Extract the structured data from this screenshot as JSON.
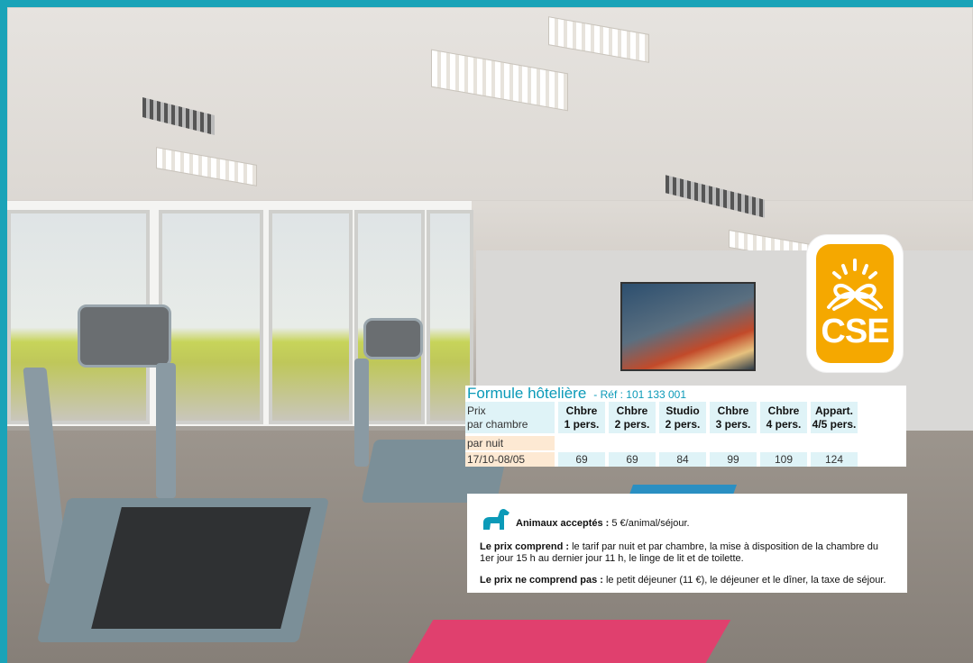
{
  "badge": {
    "label": "CSE",
    "accent": "#f5a800"
  },
  "formula": {
    "title": "Formule hôtelière",
    "ref": "- Réf : 101 133 001",
    "row_label_line1": "Prix",
    "row_label_line2": "par chambre",
    "sub_label": "par nuit",
    "columns": [
      {
        "line1": "Chbre",
        "line2": "1 pers."
      },
      {
        "line1": "Chbre",
        "line2": "2 pers."
      },
      {
        "line1": "Studio",
        "line2": "2 pers."
      },
      {
        "line1": "Chbre",
        "line2": "3 pers."
      },
      {
        "line1": "Chbre",
        "line2": "4 pers."
      },
      {
        "line1": "Appart.",
        "line2": "4/5 pers."
      }
    ],
    "rows": [
      {
        "period": "17/10-08/05",
        "values": [
          "69",
          "69",
          "84",
          "99",
          "109",
          "124"
        ]
      }
    ]
  },
  "info": {
    "pets_icon": "dog-icon",
    "pets_bold": "Animaux acceptés :",
    "pets_text": " 5 €/animal/séjour.",
    "includes_bold": "Le prix comprend :",
    "includes_text": " le tarif par nuit et par chambre, la mise à disposition de la chambre du 1er jour 15 h au dernier jour 11 h, le linge de lit et de toilette.",
    "excludes_bold": "Le prix ne comprend pas :",
    "excludes_text": " le petit déjeuner (11 €), le déjeuner et le dîner, la taxe de séjour."
  },
  "colors": {
    "teal": "#0b9ab8",
    "light_blue": "#dff3f7",
    "peach": "#fde9d3",
    "edge": "#1aa3b8"
  }
}
